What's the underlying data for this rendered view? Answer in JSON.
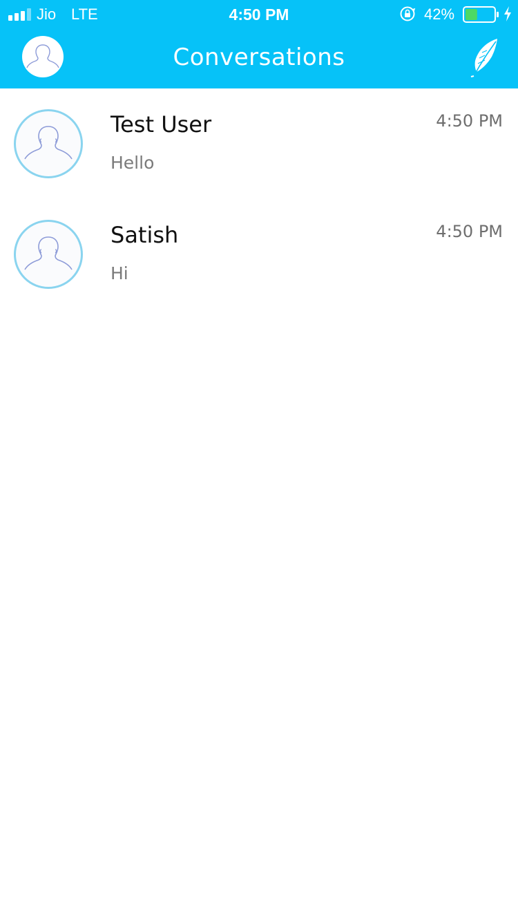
{
  "status_bar": {
    "carrier": "Jio",
    "network": "LTE",
    "time": "4:50 PM",
    "battery_percent": "42%",
    "battery_level": 0.42,
    "icons": [
      "signal-bars-icon",
      "orientation-lock-icon",
      "battery-icon",
      "charging-bolt-icon"
    ]
  },
  "header": {
    "title": "Conversations",
    "left_icon": "profile-avatar-icon",
    "right_icon": "feather-compose-icon"
  },
  "colors": {
    "accent": "#06c2f8",
    "avatar_ring": "#8ad4ef",
    "avatar_figure": "#8d9bd8",
    "battery_fill": "#4cd964"
  },
  "conversations": [
    {
      "name": "Test User",
      "preview": "Hello",
      "time": "4:50 PM"
    },
    {
      "name": "Satish",
      "preview": "Hi",
      "time": "4:50 PM"
    }
  ]
}
